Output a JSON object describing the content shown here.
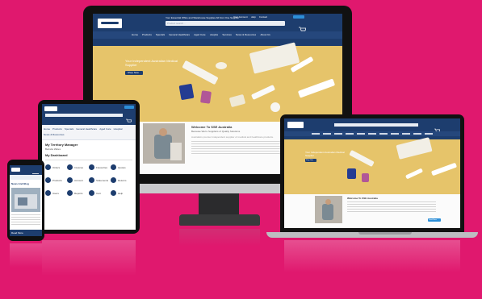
{
  "colors": {
    "background": "#e0186e",
    "site_navy": "#1d3d6e",
    "hero_sand": "#e6c46a",
    "accent_blue": "#2d8fd8"
  },
  "desktop": {
    "top_links": [
      "Your Account",
      "Help",
      "Contact",
      "Cart"
    ],
    "promo_text": "Your Essential Office and Warehouse Supplies All from One Supplier",
    "search_placeholder": "Product search...",
    "nav": [
      "Home",
      "Products",
      "Specials",
      "General Healthcare",
      "Aged Care",
      "Hospital",
      "Services",
      "News & Resources",
      "About Us"
    ],
    "hero_heading": "Your Independent Australian Medical Supplier",
    "hero_button": "Shop Now",
    "welcome_title": "Welcome To SSE Australia",
    "welcome_sub": "Because We're Suppliers of Quality Solutions",
    "welcome_body": "Australia's premier independent supplier of medical and healthcare products.",
    "welcome_button": "Read More"
  },
  "laptop": {
    "hero_heading": "Your Independent Australian Medical Supplier",
    "hero_button": "Shop Now",
    "welcome_title": "Welcome To SSE Australia",
    "welcome_button": "Read More"
  },
  "tablet": {
    "account_title": "My Territory Manager",
    "account_line": "Belinda Wales",
    "dashboard_title": "My Dashboard",
    "nav": [
      "Home",
      "Products",
      "Specials",
      "General Healthcare",
      "Aged Care",
      "Hospital",
      "News & Resources"
    ],
    "tiles": [
      "Orders",
      "Invoices",
      "Favourites",
      "Quotes",
      "Products",
      "Account",
      "Statements",
      "Returns",
      "Users",
      "Reports",
      "Cart",
      "Help"
    ]
  },
  "phone": {
    "section_title": "News And Blog",
    "footer_label": "Read More"
  }
}
